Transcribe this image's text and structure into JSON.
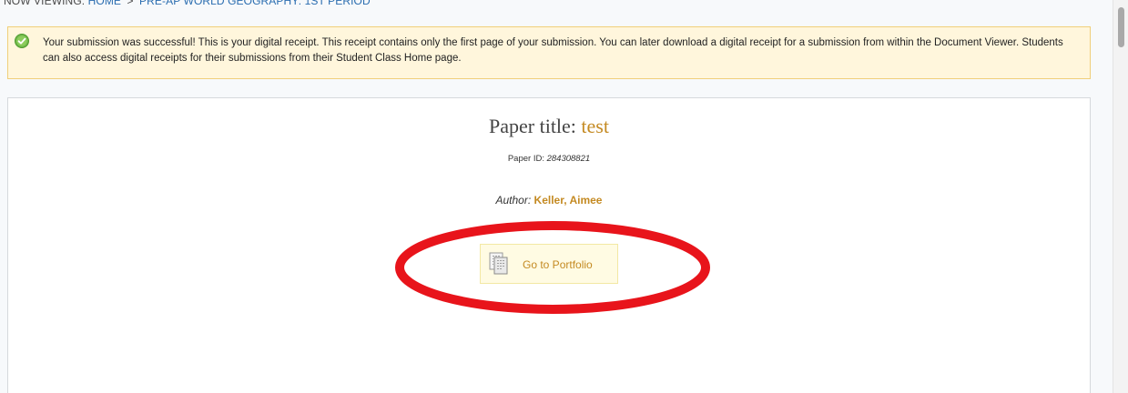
{
  "breadcrumb": {
    "prefix": "NOW VIEWING:",
    "items": [
      "HOME",
      "PRE-AP WORLD GEOGRAPHY: 1ST PERIOD"
    ],
    "separator": ">"
  },
  "banner": {
    "icon": "check-circle-icon",
    "message": "Your submission was successful! This is your digital receipt. This receipt contains only the first page of your submission. You can later download a digital receipt for a submission from within the Document Viewer. Students can also access digital receipts for their submissions from their Student Class Home page."
  },
  "receipt": {
    "title_label": "Paper title:",
    "title_value": "test",
    "paper_id_label": "Paper ID:",
    "paper_id_value": "284308821",
    "author_label": "Author:",
    "author_value": "Keller, Aimee",
    "portfolio_button": {
      "icon": "document-stack-icon",
      "label": "Go to Portfolio"
    }
  },
  "colors": {
    "accent": "#c48a22",
    "link": "#2a6db0",
    "banner_bg": "#fff6dc",
    "banner_border": "#f0cf7a",
    "annotation": "#e8141b"
  }
}
